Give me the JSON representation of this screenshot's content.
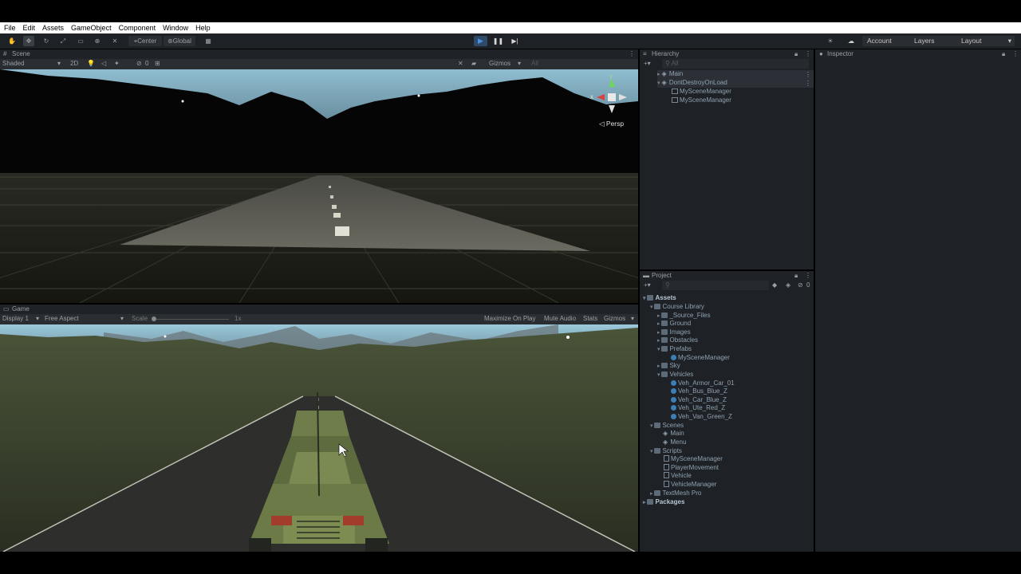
{
  "menubar": {
    "items": [
      "File",
      "Edit",
      "Assets",
      "GameObject",
      "Component",
      "Window",
      "Help"
    ]
  },
  "toolbar": {
    "pivot_label": "Center",
    "space_label": "Global",
    "account_label": "Account",
    "layers_label": "Layers",
    "layout_label": "Layout"
  },
  "scene_view": {
    "tab_label": "Scene",
    "shading_mode": "Shaded",
    "mode_2d_label": "2D",
    "hidden_count": "0",
    "gizmos_label": "Gizmos",
    "search_placeholder": "All",
    "projection_label": "Persp",
    "gizmo_x_label": "x",
    "gizmo_y_label": "y"
  },
  "game_view": {
    "tab_label": "Game",
    "display_label": "Display 1",
    "aspect_label": "Free Aspect",
    "scale_label": "Scale",
    "scale_value": "1x",
    "maximize_label": "Maximize On Play",
    "mute_label": "Mute Audio",
    "stats_label": "Stats",
    "gizmos_label": "Gizmos"
  },
  "hierarchy": {
    "tab_label": "Hierarchy",
    "search_placeholder": "All",
    "items": [
      "Main",
      "DontDestroyOnLoad",
      "MySceneManager",
      "MySceneManager"
    ]
  },
  "inspector": {
    "tab_label": "Inspector"
  },
  "project": {
    "tab_label": "Project",
    "search_placeholder": "",
    "hidden_count": "0",
    "items": [
      "Assets",
      "Course Library",
      "_Source_Files",
      "Ground",
      "Images",
      "Obstacles",
      "Prefabs",
      "MySceneManager",
      "Sky",
      "Vehicles",
      "Veh_Armor_Car_01",
      "Veh_Bus_Blue_Z",
      "Veh_Car_Blue_Z",
      "Veh_Ute_Red_Z",
      "Veh_Van_Green_Z",
      "Scenes",
      "Main",
      "Menu",
      "Scripts",
      "MySceneManager",
      "PlayerMovement",
      "Vehicle",
      "VehicleManager",
      "TextMesh Pro",
      "Packages"
    ]
  },
  "colors": {
    "accent_play": "#4a90e2",
    "panel_bg": "#1e2126",
    "menubar_bg": "#ffffff",
    "sky_top": "#8fbdd0",
    "ground_game": "#3c4632"
  }
}
